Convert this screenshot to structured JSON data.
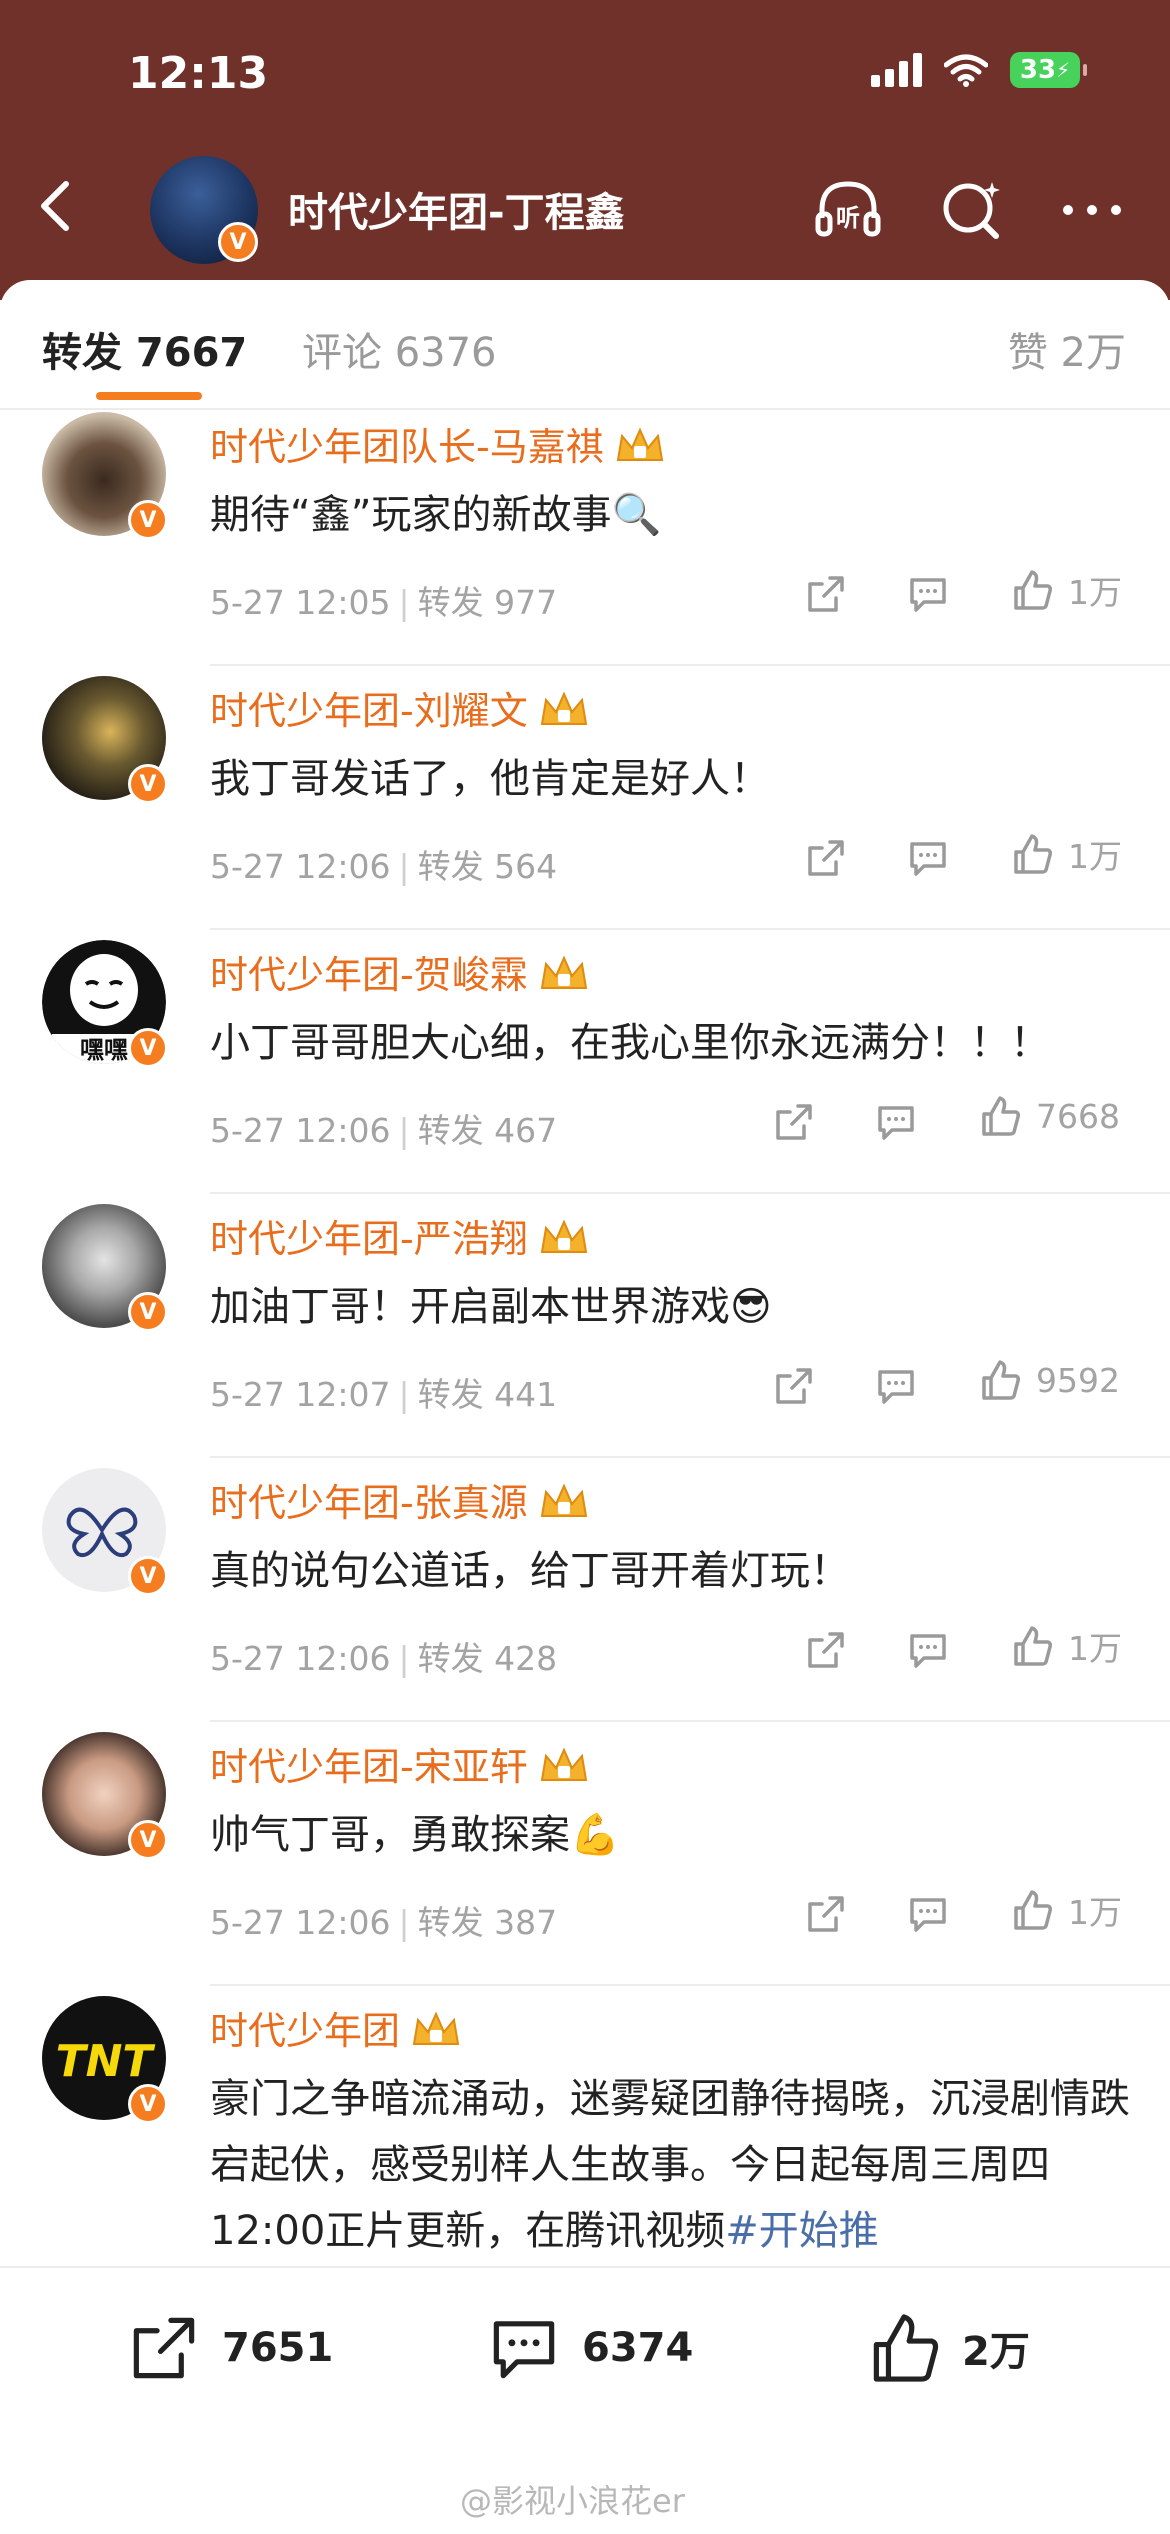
{
  "status_bar": {
    "time": "12:13",
    "battery": "33"
  },
  "header": {
    "title": "时代少年团-丁程鑫",
    "avatar_badge": "V"
  },
  "tabs": [
    {
      "label": "转发 7667",
      "active": true
    },
    {
      "label": "评论 6376",
      "active": false
    },
    {
      "label": "赞 2万",
      "active": false
    }
  ],
  "comments": [
    {
      "name": "时代少年团队长-马嘉祺",
      "text": "期待“鑫”玩家的新故事🔍",
      "date": "5-27 12:05",
      "repost": "转发 977",
      "likes": "1万"
    },
    {
      "name": "时代少年团-刘耀文",
      "text": "我丁哥发话了，他肯定是好人！",
      "date": "5-27 12:06",
      "repost": "转发 564",
      "likes": "1万"
    },
    {
      "name": "时代少年团-贺峻霖",
      "text": "小丁哥哥胆大心细，在我心里你永远满分！！！",
      "date": "5-27 12:06",
      "repost": "转发 467",
      "likes": "7668",
      "avatar_text": "嘿嘿"
    },
    {
      "name": "时代少年团-严浩翔",
      "text": "加油丁哥！开启副本世界游戏😎",
      "date": "5-27 12:07",
      "repost": "转发 441",
      "likes": "9592"
    },
    {
      "name": "时代少年团-张真源",
      "text": "真的说句公道话，给丁哥开着灯玩！",
      "date": "5-27 12:06",
      "repost": "转发 428",
      "likes": "1万"
    },
    {
      "name": "时代少年团-宋亚轩",
      "text": "帅气丁哥，勇敢探案💪",
      "date": "5-27 12:06",
      "repost": "转发 387",
      "likes": "1万"
    },
    {
      "name": "时代少年团",
      "text": "豪门之争暗流涌动，迷雾疑团静待揭晓，沉浸剧情跌宕起伏，感受别样人生故事。今日起每周三周四12:00正片更新，在腾讯视频",
      "hashtag": "#开始推",
      "avatar_text": "TNT"
    }
  ],
  "bottom_bar": {
    "repost_count": "7651",
    "comment_count": "6374",
    "like_count": "2万"
  },
  "watermark": "@影视小浪花er",
  "colors": {
    "header_bg": "#6f3129",
    "accent": "#f57c1f",
    "name": "#e86d1d",
    "hashtag": "#4a6ea8"
  }
}
